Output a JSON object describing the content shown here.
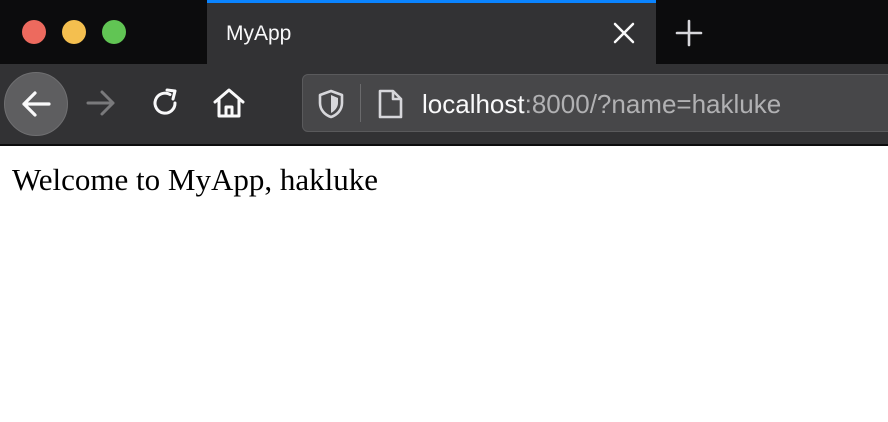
{
  "browser": {
    "tab": {
      "title": "MyApp"
    },
    "url": {
      "host": "localhost",
      "rest": ":8000/?name=hakluke"
    },
    "icons": {
      "back": "arrow-left-icon",
      "forward": "arrow-right-icon",
      "reload": "reload-icon",
      "home": "home-icon",
      "tracking": "shield-icon",
      "page": "page-icon",
      "close_tab": "close-icon",
      "new_tab": "plus-icon"
    },
    "colors": {
      "tab_accent": "#0a84ff",
      "toolbar": "#323234",
      "traffic_close": "#ed6a5e",
      "traffic_min": "#f4bf4f",
      "traffic_max": "#61c554"
    }
  },
  "page": {
    "welcome": "Welcome to MyApp, hakluke"
  }
}
